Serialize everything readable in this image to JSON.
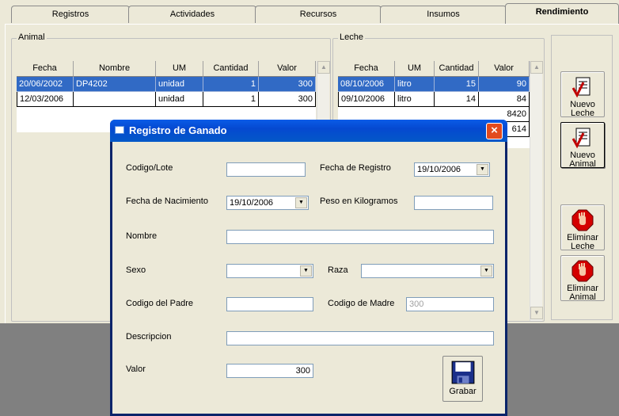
{
  "tabs": [
    {
      "label": "Registros"
    },
    {
      "label": "Actividades"
    },
    {
      "label": "Recursos"
    },
    {
      "label": "Insumos"
    },
    {
      "label": "Rendimiento",
      "active": true
    }
  ],
  "animal_group": {
    "title": "Animal",
    "columns": [
      "Fecha",
      "Nombre",
      "UM",
      "Cantidad",
      "Valor"
    ],
    "rows": [
      {
        "fecha": "20/06/2002",
        "nombre": "DP4202",
        "um": "unidad",
        "cantidad": "1",
        "valor": "300",
        "selected": true
      },
      {
        "fecha": "12/03/2006",
        "nombre": "",
        "um": "unidad",
        "cantidad": "1",
        "valor": "300"
      }
    ]
  },
  "leche_group": {
    "title": "Leche",
    "columns": [
      "Fecha",
      "UM",
      "Cantidad",
      "Valor"
    ],
    "rows": [
      {
        "fecha": "08/10/2006",
        "um": "litro",
        "cantidad": "15",
        "valor": "90",
        "selected": true
      },
      {
        "fecha": "09/10/2006",
        "um": "litro",
        "cantidad": "14",
        "valor": "84"
      },
      {
        "fecha": "",
        "um": "",
        "cantidad": "",
        "valor": "8420"
      },
      {
        "fecha": "",
        "um": "",
        "cantidad": "",
        "valor": "614"
      }
    ]
  },
  "side_buttons": [
    {
      "label": "Nuevo\nLeche",
      "icon": "clipboard-check-icon"
    },
    {
      "label": "Nuevo\nAnimal",
      "icon": "clipboard-check-icon"
    },
    {
      "label": "Eliminar\nLeche",
      "icon": "stop-hand-icon"
    },
    {
      "label": "Eliminar\nAnimal",
      "icon": "stop-hand-icon"
    }
  ],
  "dialog": {
    "title": "Registro de Ganado",
    "close_label": "×",
    "fields": {
      "codigo_lote": {
        "label": "Codigo/Lote",
        "value": ""
      },
      "fecha_registro": {
        "label": "Fecha de Registro",
        "value": "19/10/2006"
      },
      "fecha_nacimiento": {
        "label": "Fecha de Nacimiento",
        "value": "19/10/2006"
      },
      "peso": {
        "label": "Peso en Kilogramos",
        "value": ""
      },
      "nombre": {
        "label": "Nombre",
        "value": ""
      },
      "sexo": {
        "label": "Sexo",
        "value": ""
      },
      "raza": {
        "label": "Raza",
        "value": ""
      },
      "codigo_padre": {
        "label": "Codigo del Padre",
        "value": ""
      },
      "codigo_madre": {
        "label": "Codigo de Madre",
        "value": "300"
      },
      "descripcion": {
        "label": "Descripcion",
        "value": ""
      },
      "valor": {
        "label": "Valor",
        "value": "300"
      }
    },
    "grabar_label": "Grabar",
    "grabar_icon": "floppy-disk-icon"
  },
  "colors": {
    "selection": "#316ac5",
    "titlebar": "#0549d0",
    "close": "#e24a1e",
    "face": "#ece9d8"
  }
}
